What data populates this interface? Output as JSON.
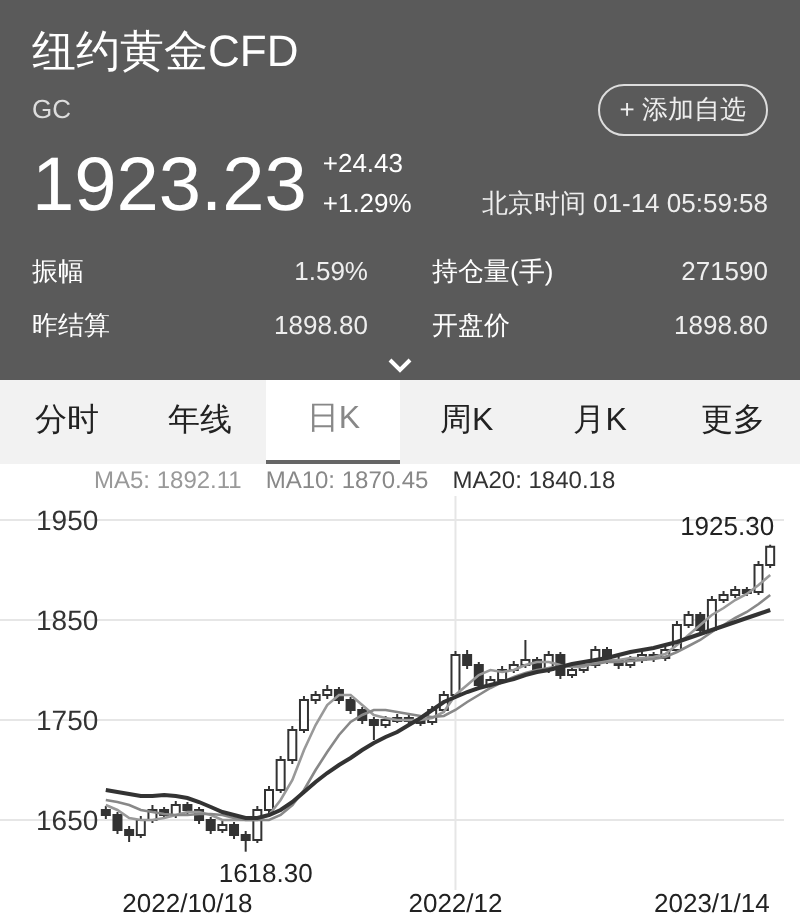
{
  "header": {
    "title": "纽约黄金CFD",
    "code": "GC",
    "add_button": "+ 添加自选",
    "price": "1923.23",
    "change": "+24.43",
    "change_pct": "+1.29%",
    "time": "北京时间 01-14 05:59:58",
    "stats": [
      {
        "label": "振幅",
        "value": "1.59%"
      },
      {
        "label": "持仓量(手)",
        "value": "271590"
      },
      {
        "label": "昨结算",
        "value": "1898.80"
      },
      {
        "label": "开盘价",
        "value": "1898.80"
      }
    ]
  },
  "tabs": [
    {
      "label": "分时",
      "selected": false
    },
    {
      "label": "年线",
      "selected": false
    },
    {
      "label": "日K",
      "selected": true
    },
    {
      "label": "周K",
      "selected": false
    },
    {
      "label": "月K",
      "selected": false
    },
    {
      "label": "更多",
      "selected": false
    }
  ],
  "chart_data": {
    "type": "candlestick",
    "categories": [
      null,
      null,
      null,
      null,
      null,
      null,
      null,
      "2022/10/18",
      null,
      null,
      null,
      null,
      null,
      null,
      null,
      null,
      null,
      null,
      null,
      null,
      null,
      null,
      null,
      null,
      null,
      null,
      null,
      null,
      null,
      null,
      "2022/12",
      null,
      null,
      null,
      null,
      null,
      null,
      null,
      null,
      null,
      null,
      null,
      null,
      null,
      null,
      null,
      null,
      null,
      null,
      null,
      null,
      null,
      "2023/1/14",
      null,
      null,
      null,
      null,
      null
    ],
    "grid": true,
    "ylim": [
      1650,
      1950
    ],
    "yticks": [
      1650,
      1750,
      1850,
      1950
    ],
    "ohlc": [
      [
        1660,
        1664,
        1651,
        1655
      ],
      [
        1655,
        1658,
        1636,
        1640
      ],
      [
        1640,
        1644,
        1628,
        1635
      ],
      [
        1635,
        1654,
        1632,
        1650
      ],
      [
        1650,
        1665,
        1647,
        1660
      ],
      [
        1660,
        1663,
        1651,
        1655
      ],
      [
        1655,
        1669,
        1652,
        1665
      ],
      [
        1665,
        1668,
        1656,
        1660
      ],
      [
        1660,
        1663,
        1646,
        1650
      ],
      [
        1650,
        1653,
        1636,
        1640
      ],
      [
        1640,
        1649,
        1637,
        1645
      ],
      [
        1645,
        1648,
        1631,
        1635
      ],
      [
        1635,
        1639,
        1618.3,
        1630
      ],
      [
        1630,
        1664,
        1627,
        1660
      ],
      [
        1660,
        1684,
        1657,
        1680
      ],
      [
        1680,
        1714,
        1677,
        1710
      ],
      [
        1710,
        1744,
        1706,
        1740
      ],
      [
        1740,
        1774,
        1737,
        1770
      ],
      [
        1770,
        1779,
        1766,
        1775
      ],
      [
        1775,
        1785,
        1771,
        1780
      ],
      [
        1780,
        1783,
        1766,
        1770
      ],
      [
        1770,
        1773,
        1756,
        1760
      ],
      [
        1760,
        1763,
        1746,
        1750
      ],
      [
        1750,
        1753,
        1730,
        1745
      ],
      [
        1745,
        1754,
        1742,
        1750
      ],
      [
        1750,
        1756,
        1747,
        1752
      ],
      [
        1752,
        1755,
        1746,
        1750
      ],
      [
        1750,
        1753,
        1744,
        1748
      ],
      [
        1748,
        1764,
        1745,
        1760
      ],
      [
        1760,
        1779,
        1757,
        1775
      ],
      [
        1775,
        1819,
        1772,
        1815
      ],
      [
        1815,
        1820,
        1801,
        1805
      ],
      [
        1805,
        1808,
        1781,
        1785
      ],
      [
        1785,
        1794,
        1782,
        1790
      ],
      [
        1790,
        1804,
        1787,
        1800
      ],
      [
        1800,
        1809,
        1797,
        1805
      ],
      [
        1805,
        1830,
        1802,
        1810
      ],
      [
        1810,
        1813,
        1796,
        1800
      ],
      [
        1800,
        1819,
        1797,
        1815
      ],
      [
        1815,
        1818,
        1791,
        1795
      ],
      [
        1795,
        1804,
        1792,
        1800
      ],
      [
        1800,
        1809,
        1797,
        1805
      ],
      [
        1805,
        1824,
        1802,
        1820
      ],
      [
        1820,
        1823,
        1806,
        1810
      ],
      [
        1810,
        1813,
        1801,
        1805
      ],
      [
        1805,
        1814,
        1802,
        1810
      ],
      [
        1810,
        1819,
        1807,
        1815
      ],
      [
        1815,
        1818,
        1808,
        1812
      ],
      [
        1812,
        1824,
        1809,
        1820
      ],
      [
        1820,
        1849,
        1817,
        1845
      ],
      [
        1845,
        1859,
        1842,
        1855
      ],
      [
        1855,
        1858,
        1836,
        1840
      ],
      [
        1840,
        1874,
        1837,
        1870
      ],
      [
        1870,
        1879,
        1867,
        1875
      ],
      [
        1875,
        1884,
        1872,
        1880
      ],
      [
        1880,
        1883,
        1874,
        1878
      ],
      [
        1878,
        1909,
        1875,
        1905
      ],
      [
        1905,
        1925.3,
        1902,
        1923.23
      ]
    ],
    "series": [
      {
        "name": "MA5: 1892.11",
        "type": "line",
        "color": "#999999",
        "values": [
          1665,
          1660,
          1652,
          1650,
          1650,
          1652,
          1655,
          1658,
          1658,
          1655,
          1650,
          1650,
          1650,
          1650,
          1655,
          1670,
          1690,
          1720,
          1745,
          1765,
          1775,
          1775,
          1765,
          1755,
          1752,
          1750,
          1750,
          1750,
          1752,
          1758,
          1775,
          1785,
          1795,
          1800,
          1798,
          1800,
          1805,
          1808,
          1808,
          1805,
          1803,
          1803,
          1808,
          1810,
          1810,
          1812,
          1812,
          1813,
          1816,
          1825,
          1835,
          1845,
          1855,
          1862,
          1870,
          1876,
          1885,
          1895
        ]
      },
      {
        "name": "MA10: 1870.45",
        "type": "line",
        "color": "#888888",
        "values": [
          1670,
          1668,
          1665,
          1660,
          1658,
          1656,
          1655,
          1655,
          1656,
          1656,
          1655,
          1652,
          1650,
          1650,
          1650,
          1655,
          1665,
          1680,
          1700,
          1718,
          1735,
          1748,
          1755,
          1760,
          1760,
          1758,
          1756,
          1754,
          1753,
          1754,
          1760,
          1768,
          1775,
          1782,
          1788,
          1793,
          1797,
          1800,
          1802,
          1804,
          1804,
          1805,
          1806,
          1808,
          1808,
          1809,
          1810,
          1811,
          1813,
          1818,
          1824,
          1830,
          1838,
          1845,
          1852,
          1858,
          1866,
          1875
        ]
      },
      {
        "name": "MA20: 1840.18",
        "type": "line",
        "color": "#333333",
        "values": [
          1680,
          1678,
          1676,
          1674,
          1674,
          1675,
          1674,
          1672,
          1668,
          1663,
          1658,
          1655,
          1652,
          1652,
          1655,
          1660,
          1668,
          1678,
          1688,
          1697,
          1705,
          1712,
          1720,
          1727,
          1733,
          1738,
          1745,
          1752,
          1760,
          1768,
          1773,
          1778,
          1782,
          1785,
          1788,
          1791,
          1795,
          1798,
          1800,
          1803,
          1806,
          1808,
          1810,
          1812,
          1815,
          1818,
          1820,
          1822,
          1825,
          1828,
          1832,
          1836,
          1840,
          1844,
          1848,
          1852,
          1856,
          1860
        ]
      }
    ],
    "annotations": [
      "1925.30",
      "1618.30"
    ]
  }
}
